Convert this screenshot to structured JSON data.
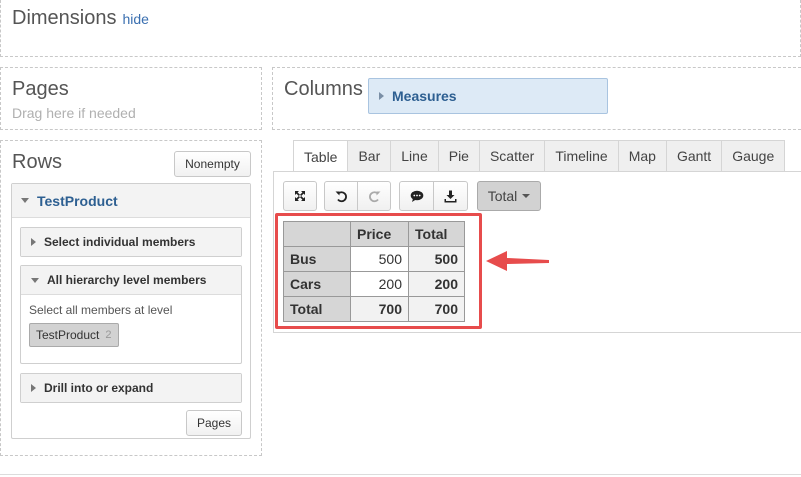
{
  "dimensions": {
    "title": "Dimensions",
    "hide_label": "hide"
  },
  "pages": {
    "title": "Pages",
    "hint": "Drag here if needed"
  },
  "columns": {
    "title": "Columns",
    "chip_label": "Measures"
  },
  "rows": {
    "title": "Rows",
    "nonempty_label": "Nonempty",
    "hierarchy": "TestProduct",
    "sections": {
      "select_individual": "Select individual members",
      "all_levels": "All hierarchy level members",
      "level_hint": "Select all members at level",
      "level_chip": "TestProduct",
      "level_count": "2",
      "drill": "Drill into or expand"
    },
    "pages_button": "Pages"
  },
  "tabs": [
    "Table",
    "Bar",
    "Line",
    "Pie",
    "Scatter",
    "Timeline",
    "Map",
    "Gantt",
    "Gauge"
  ],
  "active_tab": "Table",
  "toolbar": {
    "total_label": "Total"
  },
  "table": {
    "headers": [
      "Price",
      "Total"
    ],
    "rows": [
      {
        "label": "Bus",
        "price": "500",
        "total": "500"
      },
      {
        "label": "Cars",
        "price": "200",
        "total": "200"
      },
      {
        "label": "Total",
        "price": "700",
        "total": "700"
      }
    ]
  },
  "colors": {
    "highlight": "#e74c4c",
    "accent": "#2d5f91"
  }
}
